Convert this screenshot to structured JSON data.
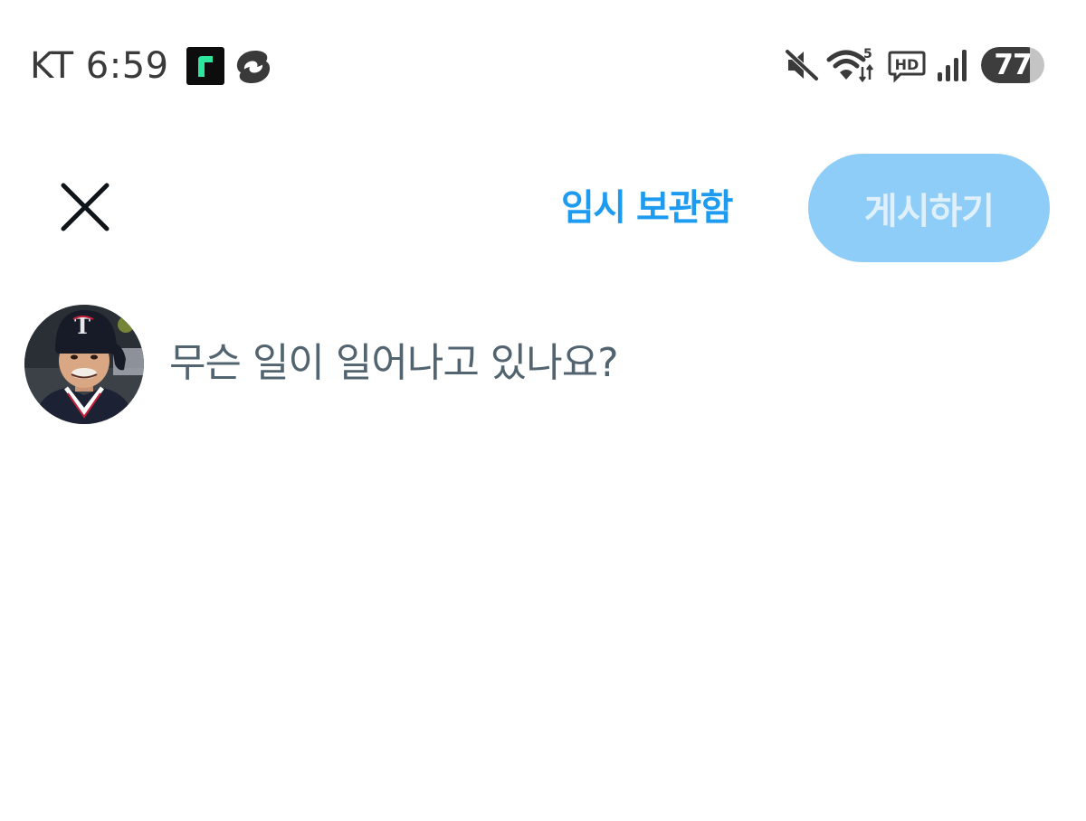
{
  "status_bar": {
    "carrier_time": "KT 6:59",
    "battery_level": "77",
    "battery_fraction": 0.77,
    "icons": [
      "r-app-icon",
      "threads-app-icon",
      "mute-icon",
      "wifi-icon",
      "hd-icon",
      "signal-icon",
      "battery-icon"
    ]
  },
  "header": {
    "close_icon": "close-icon",
    "drafts_label": "임시 보관함",
    "post_label": "게시하기"
  },
  "compose": {
    "placeholder": "무슨 일이 일어나고 있나요?",
    "value": ""
  },
  "colors": {
    "accent": "#1d9bf0",
    "post_button_disabled": "#8ecdf8",
    "post_button_text": "#dff0fd",
    "placeholder_text": "#536471"
  }
}
